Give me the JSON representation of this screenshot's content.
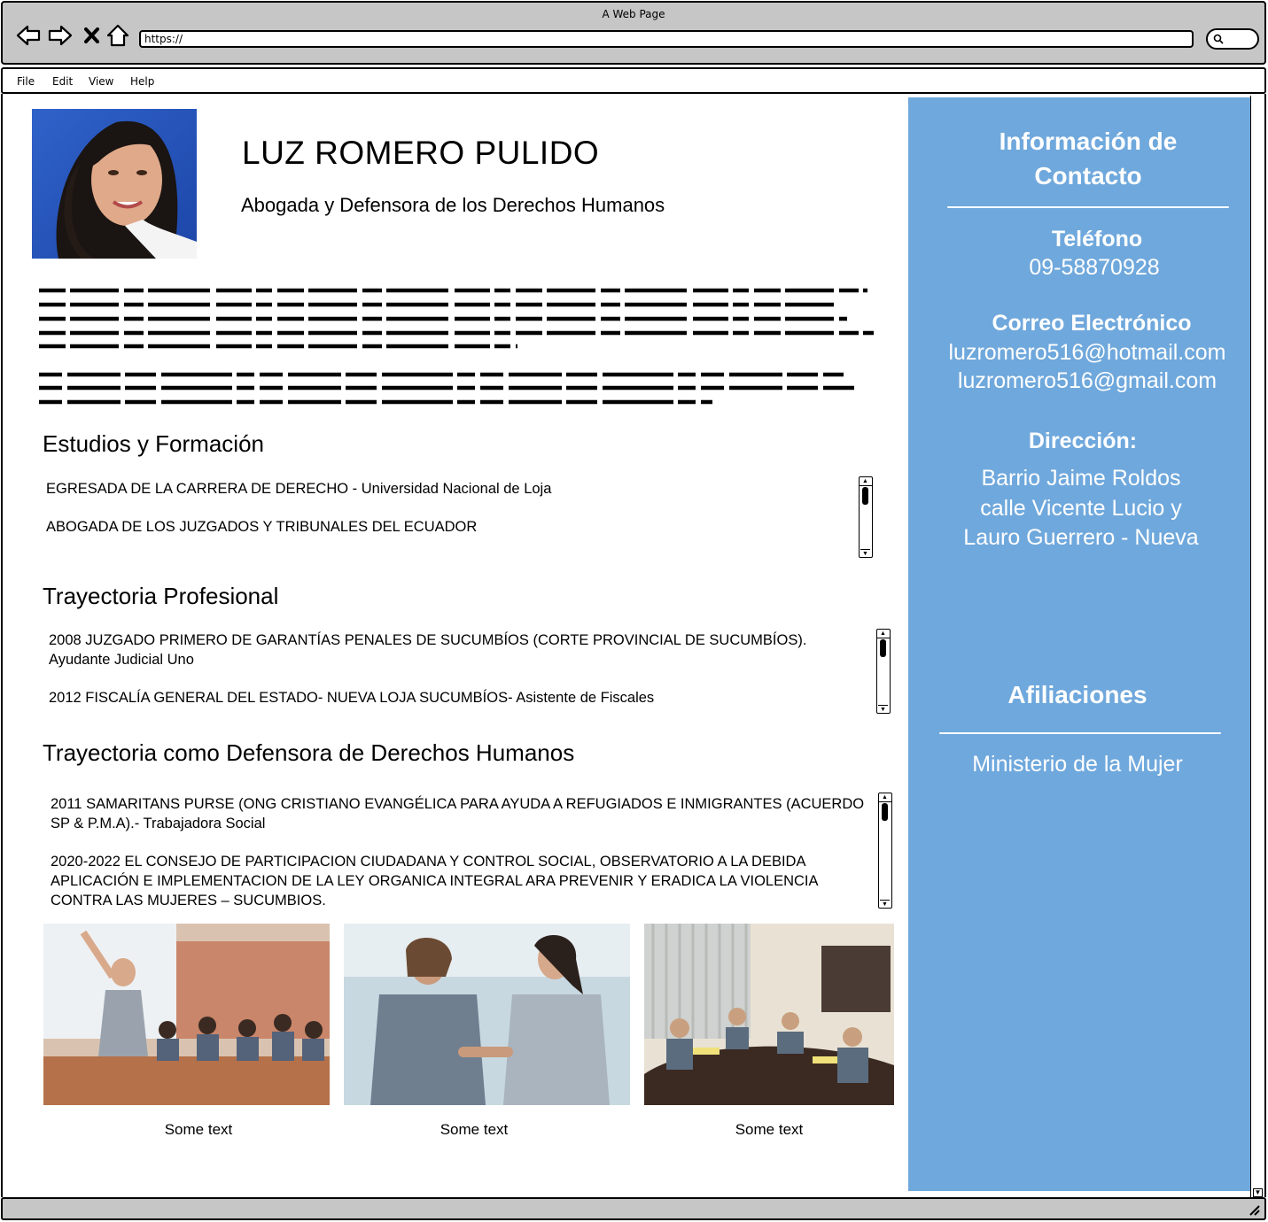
{
  "browser": {
    "window_title": "A Web Page",
    "url": "https://",
    "menu": [
      "File",
      "Edit",
      "View",
      "Help"
    ]
  },
  "profile": {
    "name": "LUZ ROMERO PULIDO",
    "role": "Abogada y Defensora de los Derechos Humanos"
  },
  "sections": {
    "studies": {
      "title": "Estudios y Formación",
      "items": [
        "EGRESADA DE LA CARRERA DE DERECHO - Universidad Nacional de Loja",
        "ABOGADA DE LOS JUZGADOS Y TRIBUNALES DEL ECUADOR"
      ]
    },
    "career": {
      "title": "Trayectoria Profesional",
      "items": [
        "2008 JUZGADO PRIMERO DE GARANTÍAS PENALES DE SUCUMBÍOS (CORTE PROVINCIAL DE SUCUMBÍOS). Ayudante Judicial Uno",
        "2012 FISCALÍA GENERAL DEL ESTADO- NUEVA LOJA SUCUMBÍOS- Asistente de Fiscales"
      ]
    },
    "rights": {
      "title": "Trayectoria como Defensora de Derechos Humanos",
      "items": [
        "2011 SAMARITANS PURSE (ONG CRISTIANO EVANGÉLICA PARA AYUDA A REFUGIADOS E INMIGRANTES (ACUERDO SP & P.M.A).- Trabajadora Social",
        "2020-2022 EL CONSEJO DE PARTICIPACION CIUDADANA Y CONTROL SOCIAL, OBSERVATORIO A LA DEBIDA APLICACIÓN E IMPLEMENTACION DE LA LEY ORGANICA INTEGRAL ARA PREVENIR Y ERADICA LA VIOLENCIA CONTRA LAS MUJERES  –  SUCUMBIOS."
      ]
    }
  },
  "gallery": {
    "captions": [
      "Some text",
      "Some text",
      "Some text"
    ]
  },
  "contact": {
    "heading": "Información de Contacto",
    "phone_label": "Teléfono",
    "phone": "09-58870928",
    "email_label": "Correo Electrónico",
    "email_1": "luzromero516@hotmail.com",
    "email_2": "luzromero516@gmail.com",
    "address_label": "Dirección:",
    "address_lines": [
      "Barrio Jaime Roldos",
      "calle Vicente Lucio y",
      "Lauro Guerrero - Nueva"
    ],
    "affiliations_heading": "Afiliaciones",
    "affiliation": "Ministerio de la Mujer"
  },
  "colors": {
    "sidebar_bg": "#6fa8dc",
    "chrome_bg": "#c6c6c6"
  }
}
